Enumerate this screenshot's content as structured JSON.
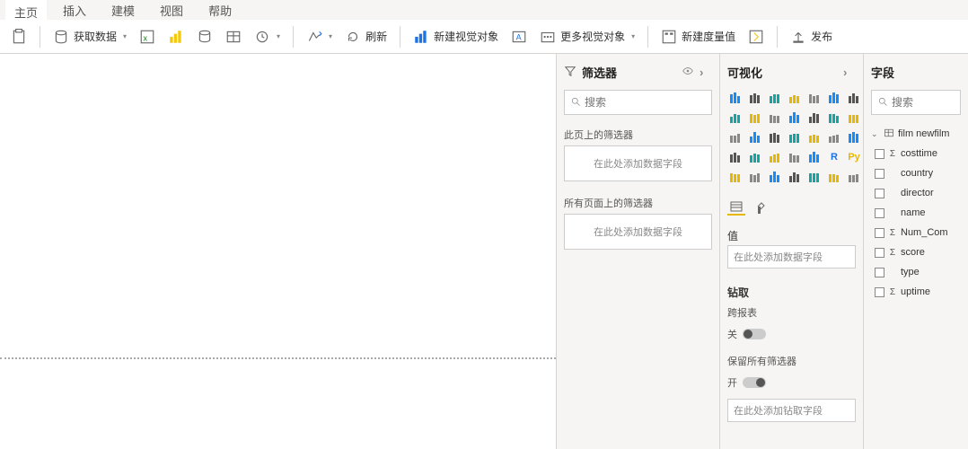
{
  "ribbon": {
    "tabs": [
      "主页",
      "插入",
      "建模",
      "视图",
      "帮助"
    ],
    "active": 0,
    "get_data": "获取数据",
    "refresh": "刷新",
    "new_visual": "新建视觉对象",
    "more_visuals": "更多视觉对象",
    "new_measure": "新建度量值",
    "publish": "发布"
  },
  "filters": {
    "title": "筛选器",
    "search_placeholder": "搜索",
    "page_filters_label": "此页上的筛选器",
    "all_pages_label": "所有页面上的筛选器",
    "drop_hint": "在此处添加数据字段"
  },
  "viz": {
    "title": "可视化",
    "values_label": "值",
    "values_hint": "在此处添加数据字段",
    "drill_label": "钻取",
    "cross_report_label": "跨报表",
    "off_label": "关",
    "keep_filters_label": "保留所有筛选器",
    "on_label": "开",
    "drill_hint": "在此处添加钻取字段",
    "types": [
      "stacked-bar",
      "stacked-column",
      "clustered-bar",
      "clustered-column",
      "100-bar",
      "100-column",
      "stacked-bar-h",
      "line",
      "area",
      "stacked-area",
      "line-column",
      "line-clustered",
      "ribbon",
      "waterfall",
      "funnel",
      "scatter",
      "pie",
      "donut",
      "treemap",
      "map",
      "filled-map",
      "card",
      "kpi",
      "slicer",
      "table",
      "matrix",
      "r",
      "py",
      "gauge",
      "multi-card",
      "key-influencers",
      "decomp",
      "qa",
      "paginated",
      "arcgis"
    ],
    "text_cells": {
      "26": "R",
      "27": "Py"
    }
  },
  "fields": {
    "title": "字段",
    "search_placeholder": "搜索",
    "table": "film newfilm",
    "columns": [
      {
        "name": "costtime",
        "sigma": true
      },
      {
        "name": "country",
        "sigma": false
      },
      {
        "name": "director",
        "sigma": false
      },
      {
        "name": "name",
        "sigma": false
      },
      {
        "name": "Num_Com",
        "sigma": true
      },
      {
        "name": "score",
        "sigma": true
      },
      {
        "name": "type",
        "sigma": false
      },
      {
        "name": "uptime",
        "sigma": true
      }
    ]
  }
}
